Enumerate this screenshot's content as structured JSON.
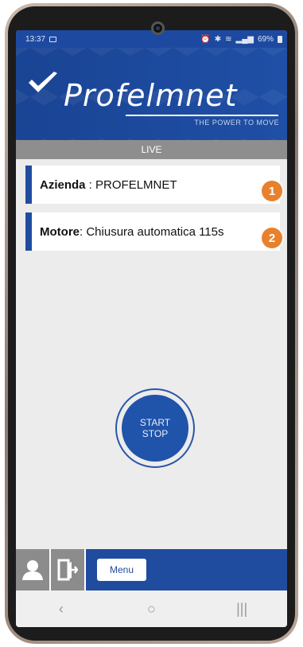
{
  "statusbar": {
    "time": "13:37",
    "battery": "69%"
  },
  "header": {
    "logo_text": "Profelmnet",
    "tagline": "THE POWER TO MOVE"
  },
  "live_label": "LIVE",
  "cards": [
    {
      "key": "Azienda",
      "separator": " : ",
      "value": "PROFELMNET",
      "badge": "1"
    },
    {
      "key": "Motore",
      "separator": ": ",
      "value": "Chiusura automatica 115s",
      "badge": "2"
    }
  ],
  "start_stop": {
    "line1": "START",
    "line2": "STOP"
  },
  "bottom": {
    "menu_label": "Menu"
  },
  "navbar": {
    "back": "‹",
    "home": "○",
    "recents": "|||"
  },
  "colors": {
    "brand_blue": "#1f4c9f",
    "badge_orange": "#e8812d",
    "live_gray": "#8e8e8e"
  }
}
